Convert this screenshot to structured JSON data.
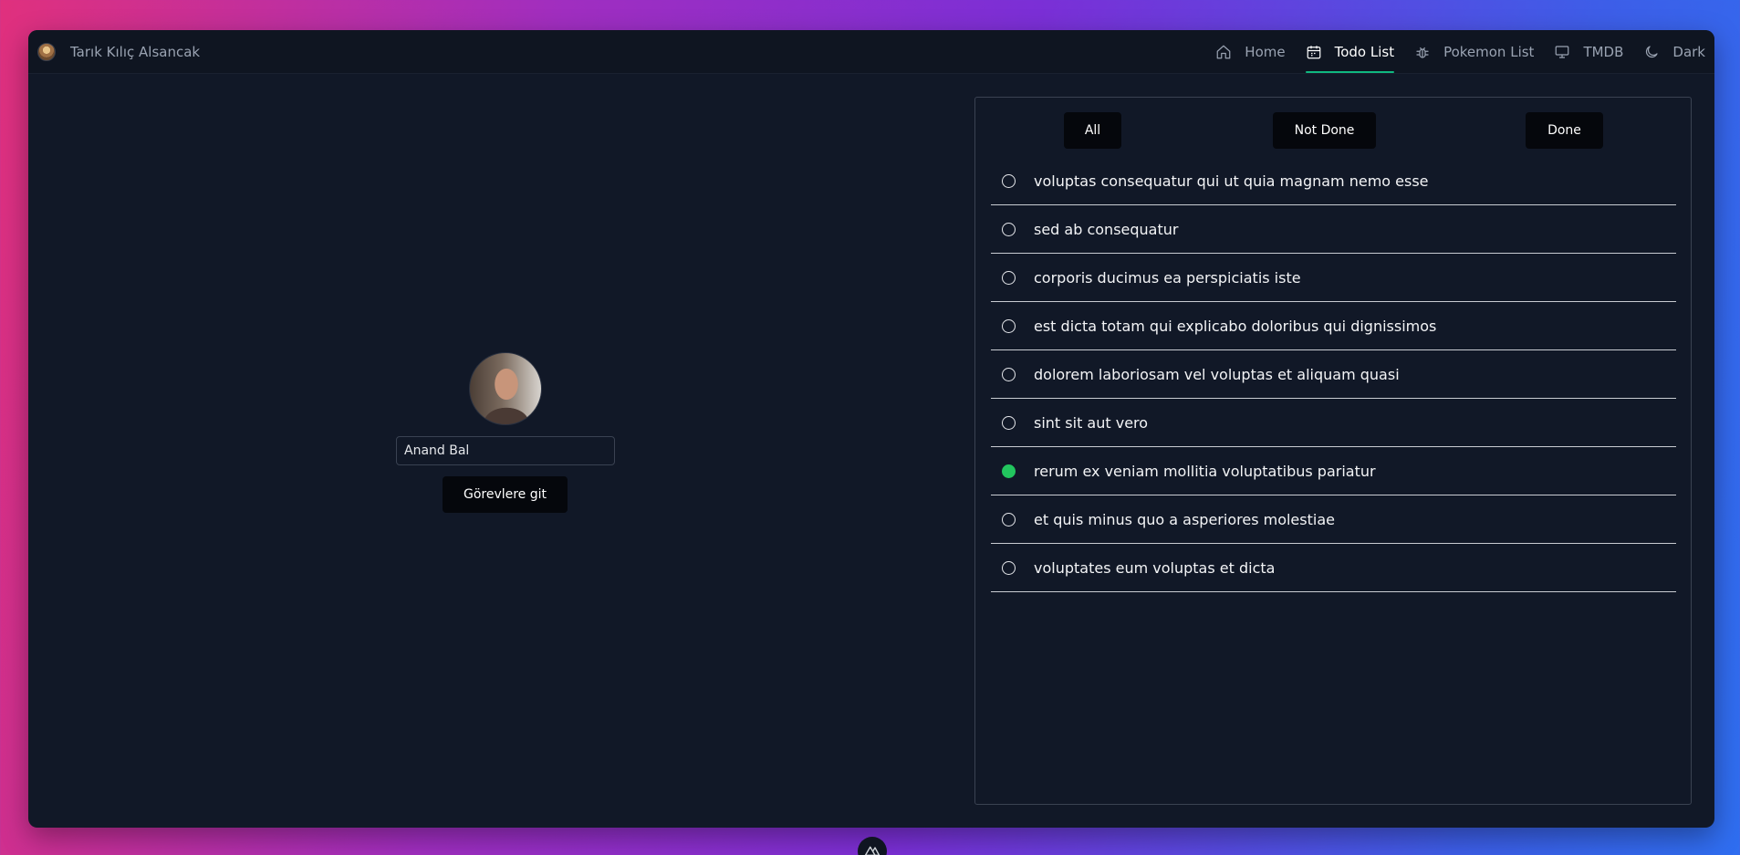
{
  "header": {
    "brand_name": "Tarık Kılıç Alsancak",
    "nav": [
      {
        "label": "Home",
        "icon": "home-icon"
      },
      {
        "label": "Todo List",
        "icon": "calendar-icon",
        "active": true
      },
      {
        "label": "Pokemon List",
        "icon": "bug-icon"
      },
      {
        "label": "TMDB",
        "icon": "monitor-icon"
      },
      {
        "label": "Dark",
        "icon": "moon-icon"
      }
    ]
  },
  "profile": {
    "name_value": "Anand Bal",
    "go_button": "Görevlere git"
  },
  "filters": {
    "all": "All",
    "not_done": "Not Done",
    "done": "Done"
  },
  "todos": [
    {
      "title": "voluptas consequatur qui ut quia magnam nemo esse",
      "completed": false
    },
    {
      "title": "sed ab consequatur",
      "completed": false
    },
    {
      "title": "corporis ducimus ea perspiciatis iste",
      "completed": false
    },
    {
      "title": "est dicta totam qui explicabo doloribus qui dignissimos",
      "completed": false
    },
    {
      "title": "dolorem laboriosam vel voluptas et aliquam quasi",
      "completed": false
    },
    {
      "title": "sint sit aut vero",
      "completed": false
    },
    {
      "title": "rerum ex veniam mollitia voluptatibus pariatur",
      "completed": true
    },
    {
      "title": "et quis minus quo a asperiores molestiae",
      "completed": false
    },
    {
      "title": "voluptates eum voluptas et dicta",
      "completed": false
    }
  ],
  "colors": {
    "accent": "#10b981",
    "done_radio": "#22c55e",
    "window_bg": "#111827"
  }
}
